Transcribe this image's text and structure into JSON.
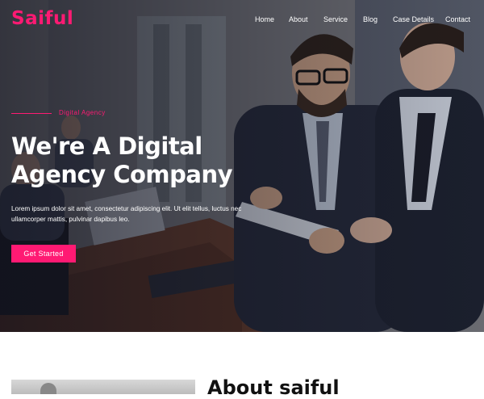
{
  "brand": {
    "logo_text": "Saiful",
    "accent_color": "#ff1a73"
  },
  "nav": {
    "items": [
      {
        "label": "Home"
      },
      {
        "label": "About"
      },
      {
        "label": "Service"
      },
      {
        "label": "Blog"
      },
      {
        "label": "Case Details"
      },
      {
        "label": "Contact"
      }
    ]
  },
  "hero": {
    "kicker": "Digital Agency",
    "headline_line1": "We're A Digital",
    "headline_line2": "Agency Company",
    "description_line1": "Lorem ipsum dolor sit amet, consectetur adipiscing elit. Ut elit tellus, luctus nec",
    "description_line2": "ullamcorper mattis, pulvinar dapibus leo.",
    "cta_label": "Get Started"
  },
  "about": {
    "title": "About saiful"
  }
}
